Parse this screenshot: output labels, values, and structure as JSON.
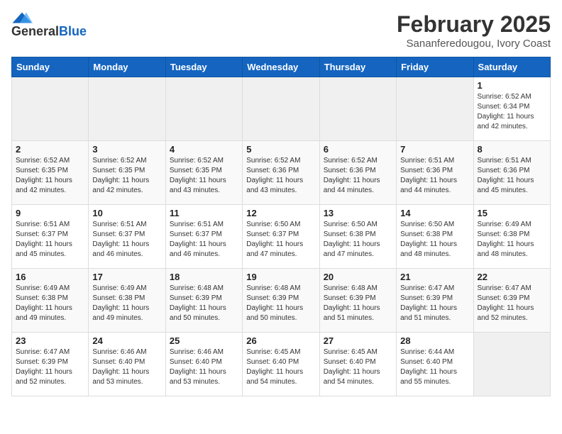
{
  "header": {
    "logo_general": "General",
    "logo_blue": "Blue",
    "title": "February 2025",
    "subtitle": "Sananferedougou, Ivory Coast"
  },
  "days_of_week": [
    "Sunday",
    "Monday",
    "Tuesday",
    "Wednesday",
    "Thursday",
    "Friday",
    "Saturday"
  ],
  "weeks": [
    [
      {
        "day": "",
        "info": ""
      },
      {
        "day": "",
        "info": ""
      },
      {
        "day": "",
        "info": ""
      },
      {
        "day": "",
        "info": ""
      },
      {
        "day": "",
        "info": ""
      },
      {
        "day": "",
        "info": ""
      },
      {
        "day": "1",
        "info": "Sunrise: 6:52 AM\nSunset: 6:34 PM\nDaylight: 11 hours\nand 42 minutes."
      }
    ],
    [
      {
        "day": "2",
        "info": "Sunrise: 6:52 AM\nSunset: 6:35 PM\nDaylight: 11 hours\nand 42 minutes."
      },
      {
        "day": "3",
        "info": "Sunrise: 6:52 AM\nSunset: 6:35 PM\nDaylight: 11 hours\nand 42 minutes."
      },
      {
        "day": "4",
        "info": "Sunrise: 6:52 AM\nSunset: 6:35 PM\nDaylight: 11 hours\nand 43 minutes."
      },
      {
        "day": "5",
        "info": "Sunrise: 6:52 AM\nSunset: 6:36 PM\nDaylight: 11 hours\nand 43 minutes."
      },
      {
        "day": "6",
        "info": "Sunrise: 6:52 AM\nSunset: 6:36 PM\nDaylight: 11 hours\nand 44 minutes."
      },
      {
        "day": "7",
        "info": "Sunrise: 6:51 AM\nSunset: 6:36 PM\nDaylight: 11 hours\nand 44 minutes."
      },
      {
        "day": "8",
        "info": "Sunrise: 6:51 AM\nSunset: 6:36 PM\nDaylight: 11 hours\nand 45 minutes."
      }
    ],
    [
      {
        "day": "9",
        "info": "Sunrise: 6:51 AM\nSunset: 6:37 PM\nDaylight: 11 hours\nand 45 minutes."
      },
      {
        "day": "10",
        "info": "Sunrise: 6:51 AM\nSunset: 6:37 PM\nDaylight: 11 hours\nand 46 minutes."
      },
      {
        "day": "11",
        "info": "Sunrise: 6:51 AM\nSunset: 6:37 PM\nDaylight: 11 hours\nand 46 minutes."
      },
      {
        "day": "12",
        "info": "Sunrise: 6:50 AM\nSunset: 6:37 PM\nDaylight: 11 hours\nand 47 minutes."
      },
      {
        "day": "13",
        "info": "Sunrise: 6:50 AM\nSunset: 6:38 PM\nDaylight: 11 hours\nand 47 minutes."
      },
      {
        "day": "14",
        "info": "Sunrise: 6:50 AM\nSunset: 6:38 PM\nDaylight: 11 hours\nand 48 minutes."
      },
      {
        "day": "15",
        "info": "Sunrise: 6:49 AM\nSunset: 6:38 PM\nDaylight: 11 hours\nand 48 minutes."
      }
    ],
    [
      {
        "day": "16",
        "info": "Sunrise: 6:49 AM\nSunset: 6:38 PM\nDaylight: 11 hours\nand 49 minutes."
      },
      {
        "day": "17",
        "info": "Sunrise: 6:49 AM\nSunset: 6:38 PM\nDaylight: 11 hours\nand 49 minutes."
      },
      {
        "day": "18",
        "info": "Sunrise: 6:48 AM\nSunset: 6:39 PM\nDaylight: 11 hours\nand 50 minutes."
      },
      {
        "day": "19",
        "info": "Sunrise: 6:48 AM\nSunset: 6:39 PM\nDaylight: 11 hours\nand 50 minutes."
      },
      {
        "day": "20",
        "info": "Sunrise: 6:48 AM\nSunset: 6:39 PM\nDaylight: 11 hours\nand 51 minutes."
      },
      {
        "day": "21",
        "info": "Sunrise: 6:47 AM\nSunset: 6:39 PM\nDaylight: 11 hours\nand 51 minutes."
      },
      {
        "day": "22",
        "info": "Sunrise: 6:47 AM\nSunset: 6:39 PM\nDaylight: 11 hours\nand 52 minutes."
      }
    ],
    [
      {
        "day": "23",
        "info": "Sunrise: 6:47 AM\nSunset: 6:39 PM\nDaylight: 11 hours\nand 52 minutes."
      },
      {
        "day": "24",
        "info": "Sunrise: 6:46 AM\nSunset: 6:40 PM\nDaylight: 11 hours\nand 53 minutes."
      },
      {
        "day": "25",
        "info": "Sunrise: 6:46 AM\nSunset: 6:40 PM\nDaylight: 11 hours\nand 53 minutes."
      },
      {
        "day": "26",
        "info": "Sunrise: 6:45 AM\nSunset: 6:40 PM\nDaylight: 11 hours\nand 54 minutes."
      },
      {
        "day": "27",
        "info": "Sunrise: 6:45 AM\nSunset: 6:40 PM\nDaylight: 11 hours\nand 54 minutes."
      },
      {
        "day": "28",
        "info": "Sunrise: 6:44 AM\nSunset: 6:40 PM\nDaylight: 11 hours\nand 55 minutes."
      },
      {
        "day": "",
        "info": ""
      }
    ]
  ]
}
